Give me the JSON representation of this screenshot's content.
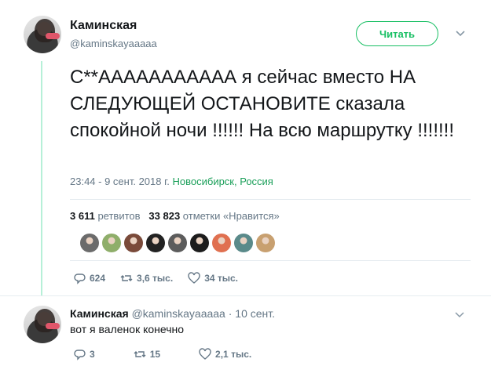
{
  "tweet": {
    "author_name": "Каминская",
    "author_handle": "@kaminskayaaaaa",
    "read_button": "Читать",
    "text": "С**ААААААААААА я сейчас вместо НА СЛЕДУЮЩЕЙ ОСТАНОВИТЕ сказала спокойной ночи !!!!!! На всю маршрутку !!!!!!!",
    "timestamp": "23:44 - 9 сент. 2018 г.",
    "location": "Новосибирск, Россия",
    "retweets_count": "3 611",
    "retweets_label": "ретвитов",
    "likes_count": "33 823",
    "likes_label": "отметки «Нравится»",
    "reply_count": "624",
    "retweet_action": "3,6 тыс.",
    "like_action": "34 тыс."
  },
  "likers": [
    "#6b6b6b",
    "#8fae6a",
    "#7a4a3a",
    "#222222",
    "#5c5c5c",
    "#1c1c1c",
    "#e07050",
    "#5a8a8a",
    "#c8a070"
  ],
  "reply": {
    "author_name": "Каминская",
    "author_handle": "@kaminskayaaaaa",
    "date": "· 10 сент.",
    "text": "вот я валенок конечно",
    "reply_count": "3",
    "retweet_count": "15",
    "like_count": "2,1 тыс."
  },
  "colors": {
    "accent": "#17bf63",
    "thread_line": "#b6f0d8",
    "muted": "#657786"
  }
}
